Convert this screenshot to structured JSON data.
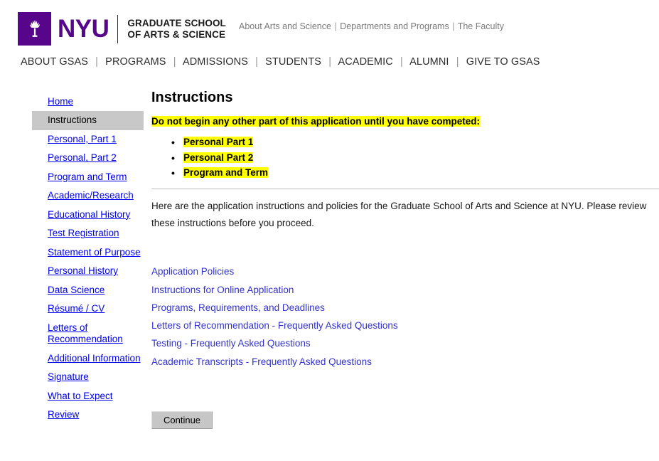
{
  "brand": {
    "logo_icon": "nyu-torch-icon",
    "wordmark": "NYU",
    "school_line1": "GRADUATE SCHOOL",
    "school_line2": "OF ARTS & SCIENCE",
    "purple": "#57068c"
  },
  "utility_nav": {
    "items": [
      {
        "label": "About Arts and Science"
      },
      {
        "label": "Departments and Programs"
      },
      {
        "label": "The Faculty"
      }
    ],
    "separator": "|"
  },
  "main_nav": {
    "separator": "|",
    "items": [
      {
        "label": "ABOUT GSAS"
      },
      {
        "label": "PROGRAMS"
      },
      {
        "label": "ADMISSIONS"
      },
      {
        "label": "STUDENTS"
      },
      {
        "label": "ACADEMIC"
      },
      {
        "label": "ALUMNI"
      },
      {
        "label": "GIVE TO GSAS"
      }
    ]
  },
  "sidebar": {
    "active_index": 1,
    "active_bg": "#c8c8c8",
    "link_color": "#0000ee",
    "items": [
      {
        "label": "Home"
      },
      {
        "label": "Instructions"
      },
      {
        "label": "Personal, Part 1"
      },
      {
        "label": "Personal, Part 2"
      },
      {
        "label": "Program and Term"
      },
      {
        "label": "Academic/Research"
      },
      {
        "label": "Educational History"
      },
      {
        "label": "Test Registration"
      },
      {
        "label": "Statement of Purpose"
      },
      {
        "label": "Personal History"
      },
      {
        "label": "Data Science"
      },
      {
        "label": "Résumé / CV"
      },
      {
        "label": "Letters of Recommendation"
      },
      {
        "label": "Additional Information"
      },
      {
        "label": "Signature"
      },
      {
        "label": "What to Expect"
      },
      {
        "label": "Review"
      }
    ]
  },
  "main": {
    "title": "Instructions",
    "warning": "Do not begin any other part of this application until you have competed:",
    "highlight_color": "#ffff00",
    "checklist": [
      {
        "label": "Personal Part 1"
      },
      {
        "label": "Personal Part 2"
      },
      {
        "label": "Program and Term"
      }
    ],
    "intro_paragraph": "Here are the application instructions and policies for the Graduate School of Arts and Science at NYU. Please review these instructions before you proceed.",
    "doc_links": [
      {
        "label": "Application Policies"
      },
      {
        "label": "Instructions for Online Application"
      },
      {
        "label": "Programs, Requirements, and Deadlines"
      },
      {
        "label": "Letters of Recommendation - Frequently Asked Questions"
      },
      {
        "label": "Testing  - Frequently Asked Questions"
      },
      {
        "label": "Academic Transcripts - Frequently Asked Questions"
      }
    ],
    "link_color": "#3333cc",
    "continue_label": "Continue"
  }
}
